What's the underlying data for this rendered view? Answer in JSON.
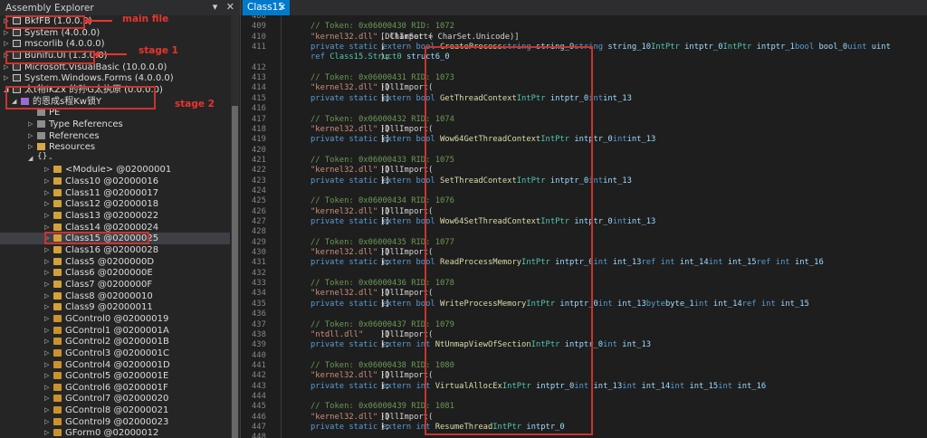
{
  "explorer": {
    "title": "Assembly Explorer",
    "header_icons": [
      "pin-icon",
      "close-icon"
    ],
    "rows": [
      {
        "arrow": "▷",
        "icon": "asm",
        "label": "BkfFB (1.0.0.0)",
        "indent": 0
      },
      {
        "arrow": "▷",
        "icon": "asm",
        "label": "System (4.0.0.0)",
        "indent": 0
      },
      {
        "arrow": "▷",
        "icon": "asm",
        "label": "mscorlib (4.0.0.0)",
        "indent": 0
      },
      {
        "arrow": "▷",
        "icon": "asm",
        "label": "Bunifu.UI (1.3.0.0)",
        "indent": 0
      },
      {
        "arrow": "▷",
        "icon": "asm",
        "label": "Microsoft.VisualBasic (10.0.0.0)",
        "indent": 0
      },
      {
        "arrow": "▷",
        "icon": "asm",
        "label": "System.Windows.Forms (4.0.0.0)",
        "indent": 0
      },
      {
        "arrow": "◢",
        "icon": "asm",
        "label": "太t物iKZx 的孙G太执原 (0.0.0.0)",
        "indent": 0
      },
      {
        "arrow": "◢",
        "icon": "mod",
        "label": "的恩成s程Kw锁Y",
        "indent": 1
      },
      {
        "arrow": "",
        "icon": "small",
        "label": "PE",
        "indent": 3
      },
      {
        "arrow": "▷",
        "icon": "small",
        "label": "Type References",
        "indent": 3
      },
      {
        "arrow": "▷",
        "icon": "small",
        "label": "References",
        "indent": 3
      },
      {
        "arrow": "▷",
        "icon": "folder",
        "label": "Resources",
        "indent": 3
      },
      {
        "arrow": "◢",
        "icon": "ns",
        "label": "-",
        "indent": 3
      },
      {
        "arrow": "▷",
        "icon": "class",
        "label": "<Module> @02000001",
        "indent": 5
      },
      {
        "arrow": "▷",
        "icon": "class",
        "label": "Class10 @02000016",
        "indent": 5
      },
      {
        "arrow": "▷",
        "icon": "class",
        "label": "Class11 @02000017",
        "indent": 5
      },
      {
        "arrow": "▷",
        "icon": "class",
        "label": "Class12 @02000018",
        "indent": 5
      },
      {
        "arrow": "▷",
        "icon": "class",
        "label": "Class13 @02000022",
        "indent": 5
      },
      {
        "arrow": "▷",
        "icon": "class",
        "label": "Class14 @02000024",
        "indent": 5
      },
      {
        "arrow": "▷",
        "icon": "class",
        "label": "Class15 @02000025",
        "indent": 5,
        "selected": true
      },
      {
        "arrow": "▷",
        "icon": "class",
        "label": "Class16 @02000028",
        "indent": 5
      },
      {
        "arrow": "▷",
        "icon": "class",
        "label": "Class5 @0200000D",
        "indent": 5
      },
      {
        "arrow": "▷",
        "icon": "class",
        "label": "Class6 @0200000E",
        "indent": 5
      },
      {
        "arrow": "▷",
        "icon": "class",
        "label": "Class7 @0200000F",
        "indent": 5
      },
      {
        "arrow": "▷",
        "icon": "class",
        "label": "Class8 @02000010",
        "indent": 5
      },
      {
        "arrow": "▷",
        "icon": "class",
        "label": "Class9 @02000011",
        "indent": 5
      },
      {
        "arrow": "▷",
        "icon": "ctrl",
        "label": "GControl0 @02000019",
        "indent": 5
      },
      {
        "arrow": "▷",
        "icon": "ctrl",
        "label": "GControl1 @0200001A",
        "indent": 5
      },
      {
        "arrow": "▷",
        "icon": "ctrl",
        "label": "GControl2 @0200001B",
        "indent": 5
      },
      {
        "arrow": "▷",
        "icon": "ctrl",
        "label": "GControl3 @0200001C",
        "indent": 5
      },
      {
        "arrow": "▷",
        "icon": "ctrl",
        "label": "GControl4 @0200001D",
        "indent": 5
      },
      {
        "arrow": "▷",
        "icon": "ctrl",
        "label": "GControl5 @0200001E",
        "indent": 5
      },
      {
        "arrow": "▷",
        "icon": "ctrl",
        "label": "GControl6 @0200001F",
        "indent": 5
      },
      {
        "arrow": "▷",
        "icon": "ctrl",
        "label": "GControl7 @02000020",
        "indent": 5
      },
      {
        "arrow": "▷",
        "icon": "ctrl",
        "label": "GControl8 @02000021",
        "indent": 5
      },
      {
        "arrow": "▷",
        "icon": "ctrl",
        "label": "GControl9 @02000023",
        "indent": 5
      },
      {
        "arrow": "▷",
        "icon": "ctrl",
        "label": "GForm0 @02000012",
        "indent": 5
      }
    ]
  },
  "annotations": {
    "main_file": "main file",
    "stage1": "stage 1",
    "stage2": "stage 2",
    "color": "#e8352b"
  },
  "editor": {
    "tab_label": "Class15",
    "tab_close": "✕",
    "lines": [
      {
        "n": "408",
        "t": []
      },
      {
        "n": "409",
        "t": [
          [
            "cm",
            "// Token: 0x06000430 RID: 1072"
          ]
        ]
      },
      {
        "n": "410",
        "t": [
          [
            "tx",
            "[DllImport("
          ],
          [
            "st",
            "\"kernel32.dll\""
          ],
          [
            "tx",
            ", CharSet = CharSet.Unicode)]"
          ]
        ]
      },
      {
        "n": "411",
        "t": [
          [
            "kw",
            "private static extern bool "
          ],
          [
            "fn",
            "CreateProcess"
          ],
          [
            "tx",
            "("
          ],
          [
            "kw",
            "string "
          ],
          [
            "pm",
            "string_9"
          ],
          [
            "tx",
            ", "
          ],
          [
            "kw",
            "string "
          ],
          [
            "pm",
            "string_10"
          ],
          [
            "tx",
            ", "
          ],
          [
            "ty",
            "IntPtr "
          ],
          [
            "pm",
            "intptr_0"
          ],
          [
            "tx",
            ", "
          ],
          [
            "ty",
            "IntPtr "
          ],
          [
            "pm",
            "intptr_1"
          ],
          [
            "tx",
            ", "
          ],
          [
            "kw",
            "bool "
          ],
          [
            "pm",
            "bool_0"
          ],
          [
            "tx",
            ", "
          ],
          [
            "kw",
            "uint "
          ],
          [
            "pm",
            "uint"
          ]
        ]
      },
      {
        "n": "",
        "t": [
          [
            "tx",
            "    "
          ],
          [
            "kw",
            "ref "
          ],
          [
            "ty",
            "Class15.Struct0 "
          ],
          [
            "pm",
            "struct6_0"
          ],
          [
            "tx",
            ");"
          ]
        ]
      },
      {
        "n": "412",
        "t": []
      },
      {
        "n": "413",
        "t": [
          [
            "cm",
            "// Token: 0x06000431 RID: 1073"
          ]
        ]
      },
      {
        "n": "414",
        "t": [
          [
            "tx",
            "[DllImport("
          ],
          [
            "st",
            "\"kernel32.dll\""
          ],
          [
            "tx",
            ")]"
          ]
        ]
      },
      {
        "n": "415",
        "t": [
          [
            "kw",
            "private static extern bool "
          ],
          [
            "fn",
            "GetThreadContext"
          ],
          [
            "tx",
            "("
          ],
          [
            "ty",
            "IntPtr "
          ],
          [
            "pm",
            "intptr_0"
          ],
          [
            "tx",
            ", "
          ],
          [
            "kw",
            "int"
          ],
          [
            "tx",
            "[] "
          ],
          [
            "pm",
            "int_13"
          ],
          [
            "tx",
            ");"
          ]
        ]
      },
      {
        "n": "416",
        "t": []
      },
      {
        "n": "417",
        "t": [
          [
            "cm",
            "// Token: 0x06000432 RID: 1074"
          ]
        ]
      },
      {
        "n": "418",
        "t": [
          [
            "tx",
            "[DllImport("
          ],
          [
            "st",
            "\"kernel32.dll\""
          ],
          [
            "tx",
            ")]"
          ]
        ]
      },
      {
        "n": "419",
        "t": [
          [
            "kw",
            "private static extern bool "
          ],
          [
            "fn",
            "Wow64GetThreadContext"
          ],
          [
            "tx",
            "("
          ],
          [
            "ty",
            "IntPtr "
          ],
          [
            "pm",
            "intptr_0"
          ],
          [
            "tx",
            ", "
          ],
          [
            "kw",
            "int"
          ],
          [
            "tx",
            "[] "
          ],
          [
            "pm",
            "int_13"
          ],
          [
            "tx",
            ");"
          ]
        ]
      },
      {
        "n": "420",
        "t": []
      },
      {
        "n": "421",
        "t": [
          [
            "cm",
            "// Token: 0x06000433 RID: 1075"
          ]
        ]
      },
      {
        "n": "422",
        "t": [
          [
            "tx",
            "[DllImport("
          ],
          [
            "st",
            "\"kernel32.dll\""
          ],
          [
            "tx",
            ")]"
          ]
        ]
      },
      {
        "n": "423",
        "t": [
          [
            "kw",
            "private static extern bool "
          ],
          [
            "fn",
            "SetThreadContext"
          ],
          [
            "tx",
            "("
          ],
          [
            "ty",
            "IntPtr "
          ],
          [
            "pm",
            "intptr_0"
          ],
          [
            "tx",
            ", "
          ],
          [
            "kw",
            "int"
          ],
          [
            "tx",
            "[] "
          ],
          [
            "pm",
            "int_13"
          ],
          [
            "tx",
            ");"
          ]
        ]
      },
      {
        "n": "424",
        "t": []
      },
      {
        "n": "425",
        "t": [
          [
            "cm",
            "// Token: 0x06000434 RID: 1076"
          ]
        ]
      },
      {
        "n": "426",
        "t": [
          [
            "tx",
            "[DllImport("
          ],
          [
            "st",
            "\"kernel32.dll\""
          ],
          [
            "tx",
            ")]"
          ]
        ]
      },
      {
        "n": "427",
        "t": [
          [
            "kw",
            "private static extern bool "
          ],
          [
            "fn",
            "Wow64SetThreadContext"
          ],
          [
            "tx",
            "("
          ],
          [
            "ty",
            "IntPtr "
          ],
          [
            "pm",
            "intptr_0"
          ],
          [
            "tx",
            ", "
          ],
          [
            "kw",
            "int"
          ],
          [
            "tx",
            "[] "
          ],
          [
            "pm",
            "int_13"
          ],
          [
            "tx",
            ");"
          ]
        ]
      },
      {
        "n": "428",
        "t": []
      },
      {
        "n": "429",
        "t": [
          [
            "cm",
            "// Token: 0x06000435 RID: 1077"
          ]
        ]
      },
      {
        "n": "430",
        "t": [
          [
            "tx",
            "[DllImport("
          ],
          [
            "st",
            "\"kernel32.dll\""
          ],
          [
            "tx",
            ")]"
          ]
        ]
      },
      {
        "n": "431",
        "t": [
          [
            "kw",
            "private static extern bool "
          ],
          [
            "fn",
            "ReadProcessMemory"
          ],
          [
            "tx",
            "("
          ],
          [
            "ty",
            "IntPtr "
          ],
          [
            "pm",
            "intptr_0"
          ],
          [
            "tx",
            ", "
          ],
          [
            "kw",
            "int "
          ],
          [
            "pm",
            "int_13"
          ],
          [
            "tx",
            ", "
          ],
          [
            "kw",
            "ref int "
          ],
          [
            "pm",
            "int_14"
          ],
          [
            "tx",
            ", "
          ],
          [
            "kw",
            "int "
          ],
          [
            "pm",
            "int_15"
          ],
          [
            "tx",
            ", "
          ],
          [
            "kw",
            "ref int "
          ],
          [
            "pm",
            "int_16"
          ],
          [
            "tx",
            ");"
          ]
        ]
      },
      {
        "n": "432",
        "t": []
      },
      {
        "n": "433",
        "t": [
          [
            "cm",
            "// Token: 0x06000436 RID: 1078"
          ]
        ]
      },
      {
        "n": "434",
        "t": [
          [
            "tx",
            "[DllImport("
          ],
          [
            "st",
            "\"kernel32.dll\""
          ],
          [
            "tx",
            ")]"
          ]
        ]
      },
      {
        "n": "435",
        "t": [
          [
            "kw",
            "private static extern bool "
          ],
          [
            "fn",
            "WriteProcessMemory"
          ],
          [
            "tx",
            "("
          ],
          [
            "ty",
            "IntPtr "
          ],
          [
            "pm",
            "intptr_0"
          ],
          [
            "tx",
            ", "
          ],
          [
            "kw",
            "int "
          ],
          [
            "pm",
            "int_13"
          ],
          [
            "tx",
            ", "
          ],
          [
            "kw",
            "byte"
          ],
          [
            "tx",
            "[] "
          ],
          [
            "pm",
            "byte_1"
          ],
          [
            "tx",
            ", "
          ],
          [
            "kw",
            "int "
          ],
          [
            "pm",
            "int_14"
          ],
          [
            "tx",
            ", "
          ],
          [
            "kw",
            "ref int "
          ],
          [
            "pm",
            "int_15"
          ],
          [
            "tx",
            ");"
          ]
        ]
      },
      {
        "n": "436",
        "t": []
      },
      {
        "n": "437",
        "t": [
          [
            "cm",
            "// Token: 0x06000437 RID: 1079"
          ]
        ]
      },
      {
        "n": "438",
        "t": [
          [
            "tx",
            "[DllImport("
          ],
          [
            "st",
            "\"ntdll.dll\""
          ],
          [
            "tx",
            ")]"
          ]
        ]
      },
      {
        "n": "439",
        "t": [
          [
            "kw",
            "private static extern int "
          ],
          [
            "fn",
            "NtUnmapViewOfSection"
          ],
          [
            "tx",
            "("
          ],
          [
            "ty",
            "IntPtr "
          ],
          [
            "pm",
            "intptr_0"
          ],
          [
            "tx",
            ", "
          ],
          [
            "kw",
            "int "
          ],
          [
            "pm",
            "int_13"
          ],
          [
            "tx",
            ");"
          ]
        ]
      },
      {
        "n": "440",
        "t": []
      },
      {
        "n": "441",
        "t": [
          [
            "cm",
            "// Token: 0x06000438 RID: 1080"
          ]
        ]
      },
      {
        "n": "442",
        "t": [
          [
            "tx",
            "[DllImport("
          ],
          [
            "st",
            "\"kernel32.dll\""
          ],
          [
            "tx",
            ")]"
          ]
        ]
      },
      {
        "n": "443",
        "t": [
          [
            "kw",
            "private static extern int "
          ],
          [
            "fn",
            "VirtualAllocEx"
          ],
          [
            "tx",
            "("
          ],
          [
            "ty",
            "IntPtr "
          ],
          [
            "pm",
            "intptr_0"
          ],
          [
            "tx",
            ", "
          ],
          [
            "kw",
            "int "
          ],
          [
            "pm",
            "int_13"
          ],
          [
            "tx",
            ", "
          ],
          [
            "kw",
            "int "
          ],
          [
            "pm",
            "int_14"
          ],
          [
            "tx",
            ", "
          ],
          [
            "kw",
            "int "
          ],
          [
            "pm",
            "int_15"
          ],
          [
            "tx",
            ", "
          ],
          [
            "kw",
            "int "
          ],
          [
            "pm",
            "int_16"
          ],
          [
            "tx",
            ");"
          ]
        ]
      },
      {
        "n": "444",
        "t": []
      },
      {
        "n": "445",
        "t": [
          [
            "cm",
            "// Token: 0x06000439 RID: 1081"
          ]
        ]
      },
      {
        "n": "446",
        "t": [
          [
            "tx",
            "[DllImport("
          ],
          [
            "st",
            "\"kernel32.dll\""
          ],
          [
            "tx",
            ")]"
          ]
        ]
      },
      {
        "n": "447",
        "t": [
          [
            "kw",
            "private static extern int "
          ],
          [
            "fn",
            "ResumeThread"
          ],
          [
            "tx",
            "("
          ],
          [
            "ty",
            "IntPtr "
          ],
          [
            "pm",
            "intptr_0"
          ],
          [
            "tx",
            ");"
          ]
        ]
      },
      {
        "n": "448",
        "t": []
      }
    ]
  }
}
